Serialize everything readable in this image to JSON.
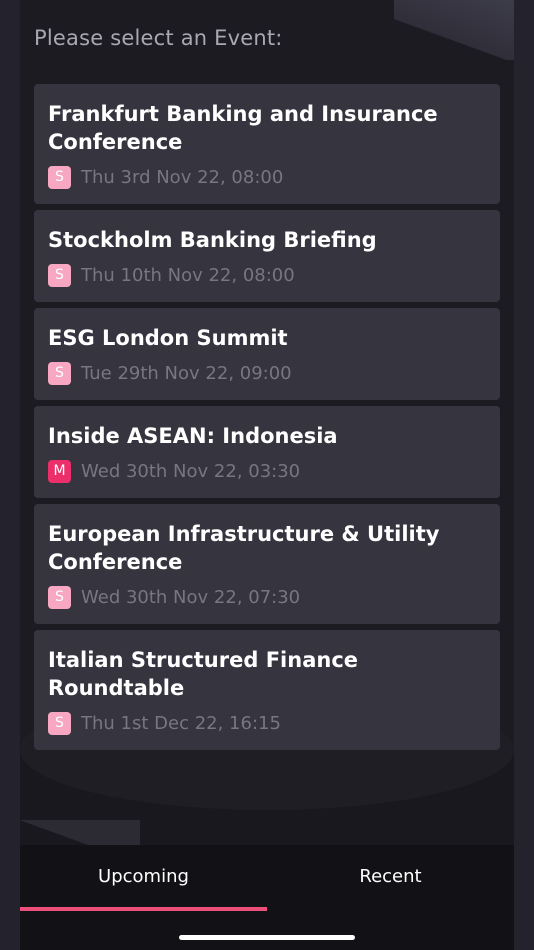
{
  "prompt": "Please select an Event:",
  "events": [
    {
      "title": "Frankfurt Banking and Insurance Conference",
      "badge": "S",
      "date": "Thu 3rd Nov 22, 08:00"
    },
    {
      "title": "Stockholm Banking Briefing",
      "badge": "S",
      "date": "Thu 10th Nov 22, 08:00"
    },
    {
      "title": "ESG London Summit",
      "badge": "S",
      "date": "Tue 29th Nov 22, 09:00"
    },
    {
      "title": "Inside ASEAN: Indonesia",
      "badge": "M",
      "date": "Wed 30th Nov 22, 03:30"
    },
    {
      "title": "European Infrastructure & Utility Conference",
      "badge": "S",
      "date": "Wed 30th Nov 22, 07:30"
    },
    {
      "title": "Italian Structured Finance Roundtable",
      "badge": "S",
      "date": "Thu 1st Dec 22, 16:15"
    }
  ],
  "tabs": {
    "upcoming": "Upcoming",
    "recent": "Recent",
    "active": "upcoming"
  },
  "colors": {
    "badge_s": "#f7a7c1",
    "badge_m": "#ec2f6a",
    "accent": "#ec4f7a",
    "card": "#35343f"
  }
}
